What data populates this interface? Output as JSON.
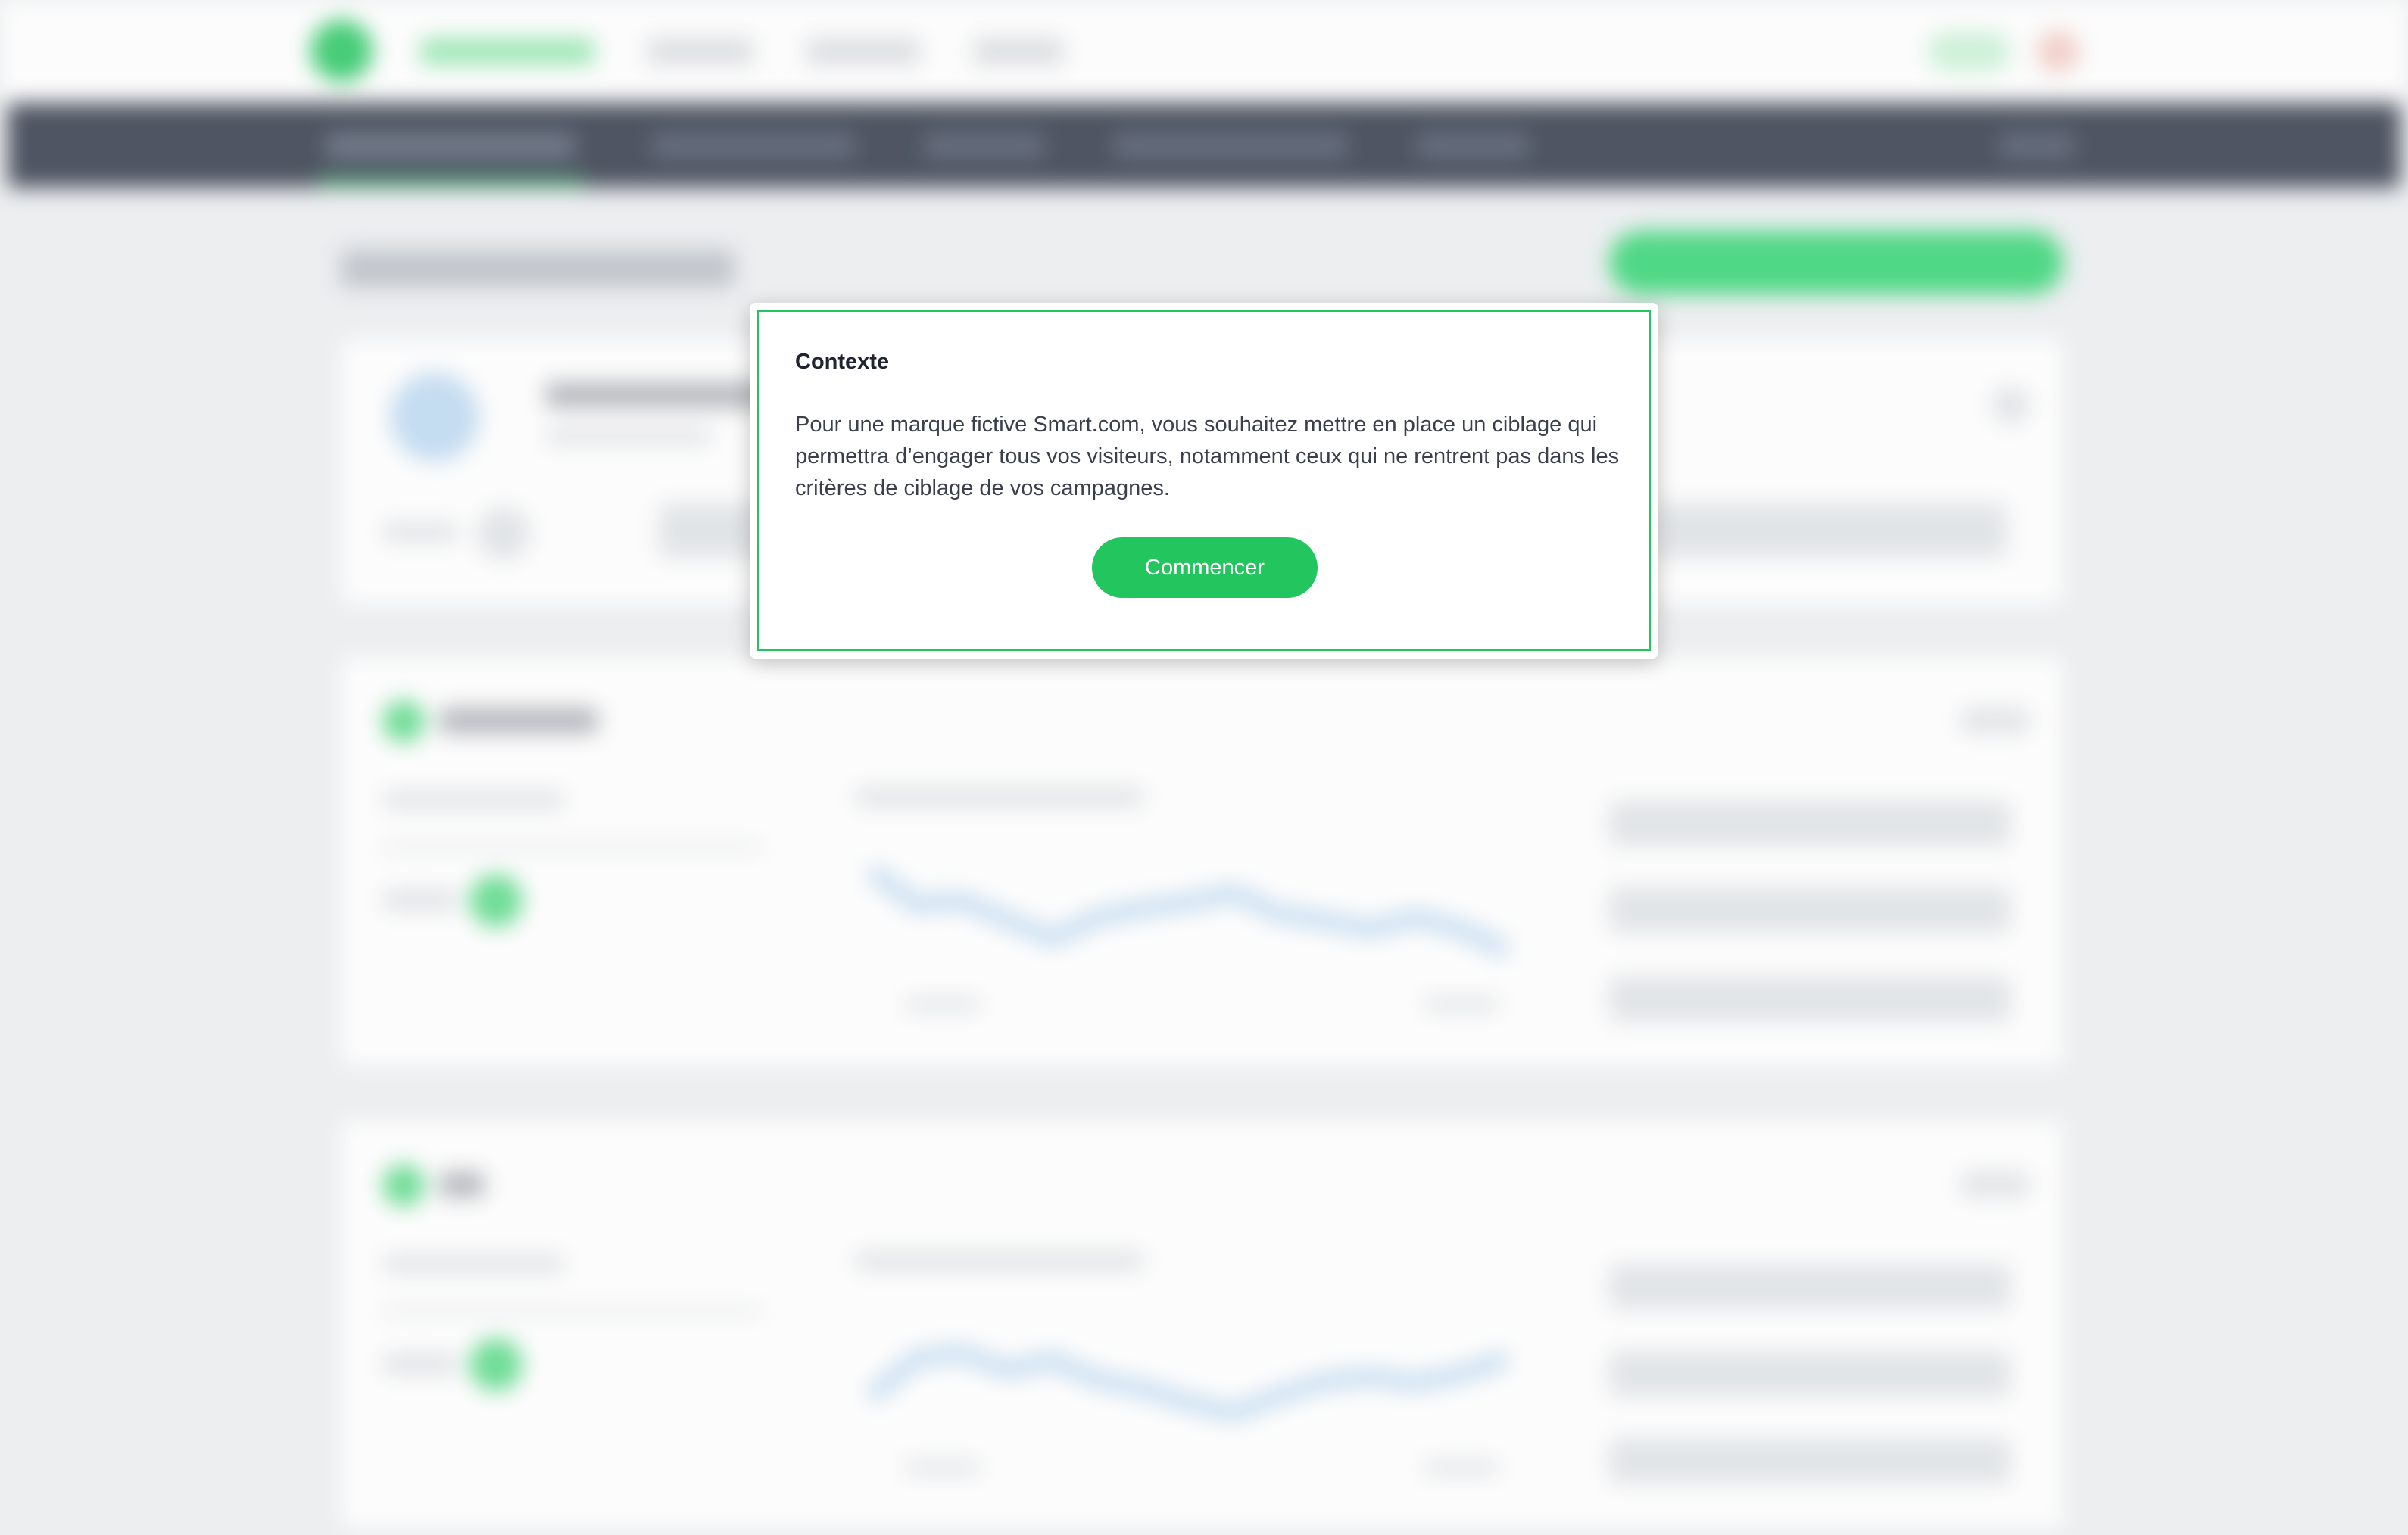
{
  "modal": {
    "title": "Contexte",
    "body": "Pour une marque fictive Smart.com, vous souhaitez mettre en place un ciblage qui permettra d’engager tous vos visiteurs, notamment ceux qui ne rentrent pas dans les critères de ciblage de vos campagnes.",
    "button_label": "Commencer"
  },
  "colors": {
    "accent": "#22c55e",
    "nav_dark": "#2c3444",
    "page_background": "#eceef1",
    "chart_line": "#bcd9f2"
  }
}
